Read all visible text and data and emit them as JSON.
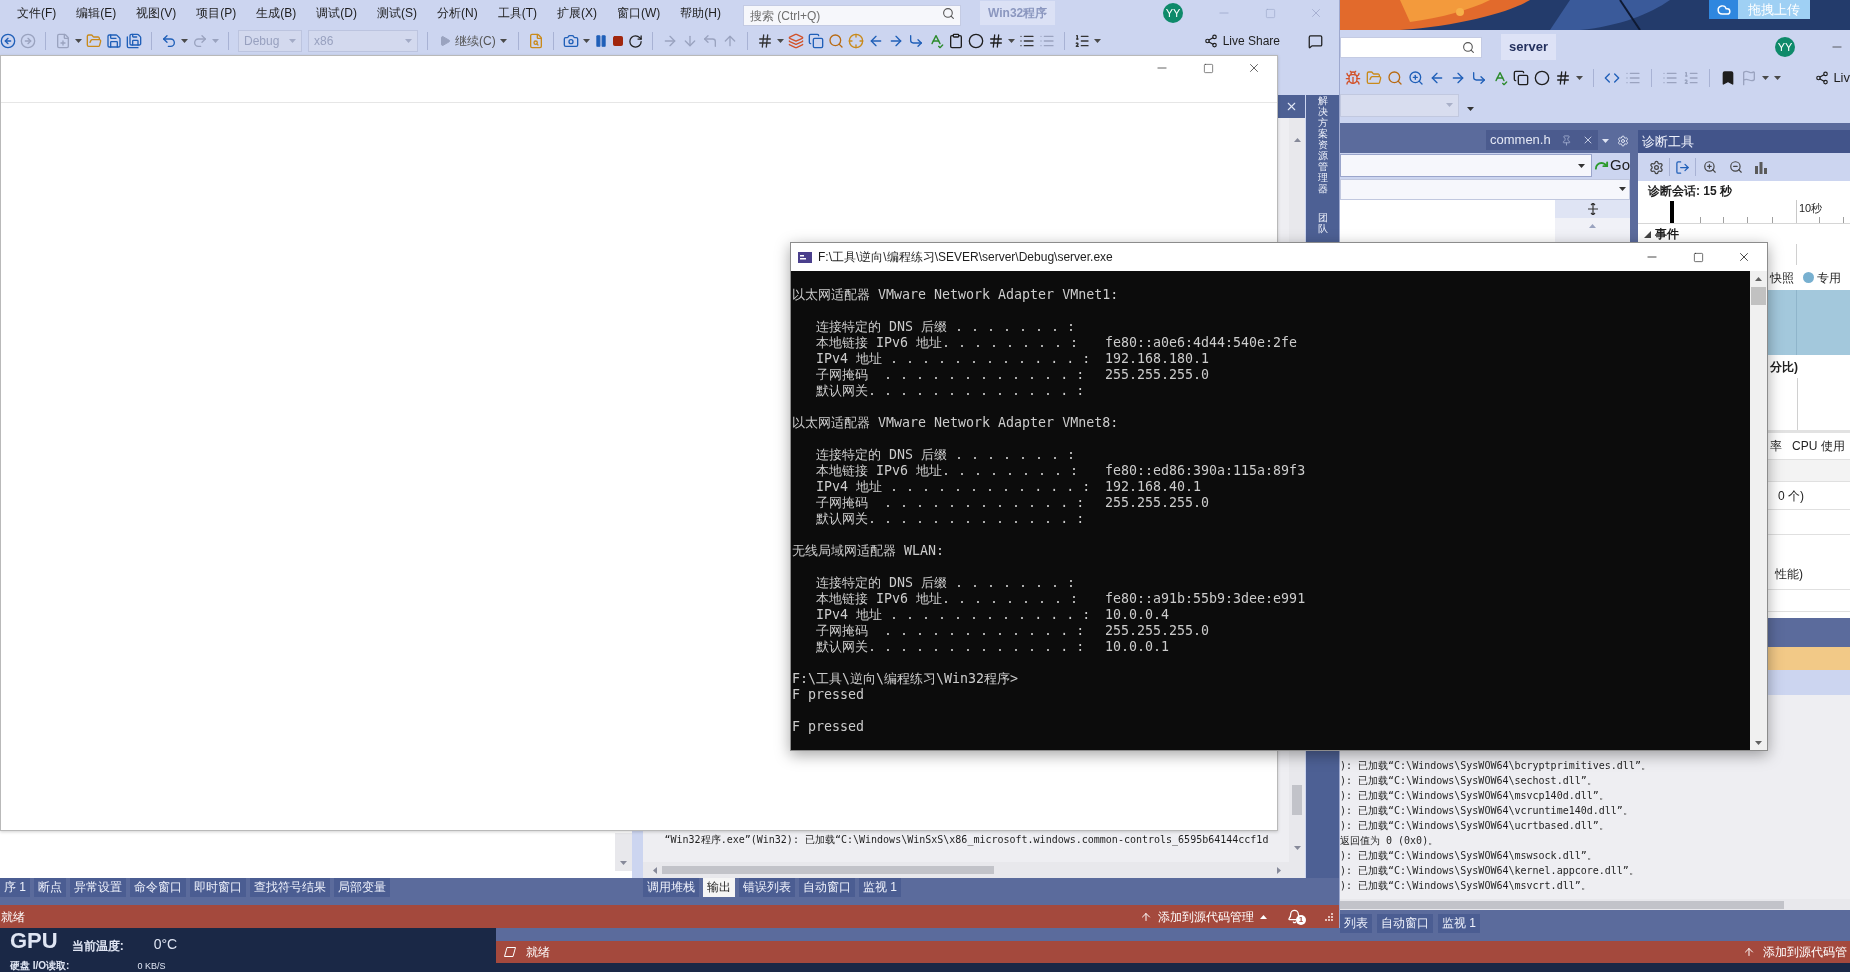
{
  "desktop": {
    "upload_button": "拖拽上传",
    "widget": {
      "gpu_label": "GPU",
      "temperature_label": "当前温度:",
      "temperature_value": "0°C",
      "disk_label": "硬盘 I/O读取:",
      "disk_value": "0 KB/S"
    }
  },
  "vs_main": {
    "menu": [
      "文件(F)",
      "编辑(E)",
      "视图(V)",
      "项目(P)",
      "生成(B)",
      "调试(D)",
      "测试(S)",
      "分析(N)",
      "工具(T)",
      "扩展(X)",
      "窗口(W)",
      "帮助(H)"
    ],
    "search": {
      "placeholder": "搜索 (Ctrl+Q)"
    },
    "solution_name": "Win32程序",
    "avatar": "YY",
    "toolbar": {
      "configuration": {
        "value": "Debug",
        "disabled": true
      },
      "platform": {
        "value": "x86",
        "disabled": true
      },
      "continue_button": "继续(C)",
      "live_share": "Live Share"
    },
    "side_tabs": [
      "解决方案资源管理器",
      "团队"
    ],
    "output_line": "“Win32程序.exe”(Win32): 已加载“C:\\Windows\\WinSxS\\x86_microsoft.windows.common-controls_6595b64144ccf1d",
    "bottom_tabs_left": [
      {
        "label": "序 1",
        "selected": false
      },
      {
        "label": "断点",
        "selected": false
      },
      {
        "label": "异常设置",
        "selected": false
      },
      {
        "label": "命令窗口",
        "selected": false
      },
      {
        "label": "即时窗口",
        "selected": false
      },
      {
        "label": "查找符号结果",
        "selected": false
      },
      {
        "label": "局部变量",
        "selected": false
      }
    ],
    "bottom_tabs_right": [
      {
        "label": "调用堆栈",
        "selected": false
      },
      {
        "label": "输出",
        "selected": true
      },
      {
        "label": "错误列表",
        "selected": false
      },
      {
        "label": "自动窗口",
        "selected": false
      },
      {
        "label": "监视 1",
        "selected": false
      }
    ],
    "status_bar": {
      "text": "就绪",
      "source_control": "添加到源代码管理",
      "notification_count": "1"
    }
  },
  "console": {
    "title": "F:\\工具\\逆向\\编程练习\\SEVER\\server\\Debug\\server.exe",
    "lines": [
      {
        "kind": "blank"
      },
      {
        "kind": "text",
        "text": "以太网适配器 VMware Network Adapter VMnet1:"
      },
      {
        "kind": "blank"
      },
      {
        "kind": "field",
        "label": "连接特定的 DNS 后缀 . . . . . . . :"
      },
      {
        "kind": "field",
        "label": "本地链接 IPv6 地址. . . . . . . . :",
        "value": "fe80::a0e6:4d44:540e:2fe"
      },
      {
        "kind": "field",
        "label": "IPv4 地址 . . . . . . . . . . . . :",
        "value": "192.168.180.1"
      },
      {
        "kind": "field",
        "label": "子网掩码  . . . . . . . . . . . . :",
        "value": "255.255.255.0"
      },
      {
        "kind": "field",
        "label": "默认网关. . . . . . . . . . . . . :"
      },
      {
        "kind": "blank"
      },
      {
        "kind": "text",
        "text": "以太网适配器 VMware Network Adapter VMnet8:"
      },
      {
        "kind": "blank"
      },
      {
        "kind": "field",
        "label": "连接特定的 DNS 后缀 . . . . . . . :"
      },
      {
        "kind": "field",
        "label": "本地链接 IPv6 地址. . . . . . . . :",
        "value": "fe80::ed86:390a:115a:89f3"
      },
      {
        "kind": "field",
        "label": "IPv4 地址 . . . . . . . . . . . . :",
        "value": "192.168.40.1"
      },
      {
        "kind": "field",
        "label": "子网掩码  . . . . . . . . . . . . :",
        "value": "255.255.255.0"
      },
      {
        "kind": "field",
        "label": "默认网关. . . . . . . . . . . . . :"
      },
      {
        "kind": "blank"
      },
      {
        "kind": "text",
        "text": "无线局域网适配器 WLAN:"
      },
      {
        "kind": "blank"
      },
      {
        "kind": "field",
        "label": "连接特定的 DNS 后缀 . . . . . . . :"
      },
      {
        "kind": "field",
        "label": "本地链接 IPv6 地址. . . . . . . . :",
        "value": "fe80::a91b:55b9:3dee:e991"
      },
      {
        "kind": "field",
        "label": "IPv4 地址 . . . . . . . . . . . . :",
        "value": "10.0.0.4"
      },
      {
        "kind": "field",
        "label": "子网掩码  . . . . . . . . . . . . :",
        "value": "255.255.255.0"
      },
      {
        "kind": "field",
        "label": "默认网关. . . . . . . . . . . . . :",
        "value": "10.0.0.1"
      },
      {
        "kind": "blank"
      },
      {
        "kind": "text",
        "text": "F:\\工具\\逆向\\编程练习\\Win32程序>"
      },
      {
        "kind": "text",
        "text": "F pressed"
      },
      {
        "kind": "blank"
      },
      {
        "kind": "text",
        "text": "F pressed"
      }
    ]
  },
  "vs_server": {
    "solution_name": "server",
    "avatar": "YY",
    "live_share": "Liv",
    "document_tab": "commen.h",
    "go_button": "Go",
    "diagnostics": {
      "title": "诊断工具",
      "session": "诊断会话: 15 秒",
      "timeline_label": "10秒",
      "events_header": "事件",
      "snapshot_label": "快照",
      "legend_label": "专用",
      "percent_caption": "分比)",
      "column_1": "率",
      "column_2": "CPU 使用",
      "count_caption": "0 个)",
      "performance_caption": "性能)"
    },
    "output_lines": [
      "): 已加载“C:\\Windows\\SysWOW64\\bcryptprimitives.dll”。",
      "): 已加载“C:\\Windows\\SysWOW64\\sechost.dll”。",
      "): 已加载“C:\\Windows\\SysWOW64\\msvcp140d.dll”。",
      "): 已加载“C:\\Windows\\SysWOW64\\vcruntime140d.dll”。",
      "): 已加载“C:\\Windows\\SysWOW64\\ucrtbased.dll”。",
      "返回值为 0 (0x0)。",
      "): 已加载“C:\\Windows\\SysWOW64\\mswsock.dll”。",
      "): 已加载“C:\\Windows\\SysWOW64\\kernel.appcore.dll”。",
      "): 已加载“C:\\Windows\\SysWOW64\\msvcrt.dll”。"
    ],
    "bottom_tabs": [
      {
        "label": "列表",
        "selected": false
      },
      {
        "label": "自动窗口",
        "selected": false
      },
      {
        "label": "监视 1",
        "selected": false
      }
    ],
    "status_bar": {
      "text": "就绪",
      "source_control": "添加到源代码管"
    }
  }
}
